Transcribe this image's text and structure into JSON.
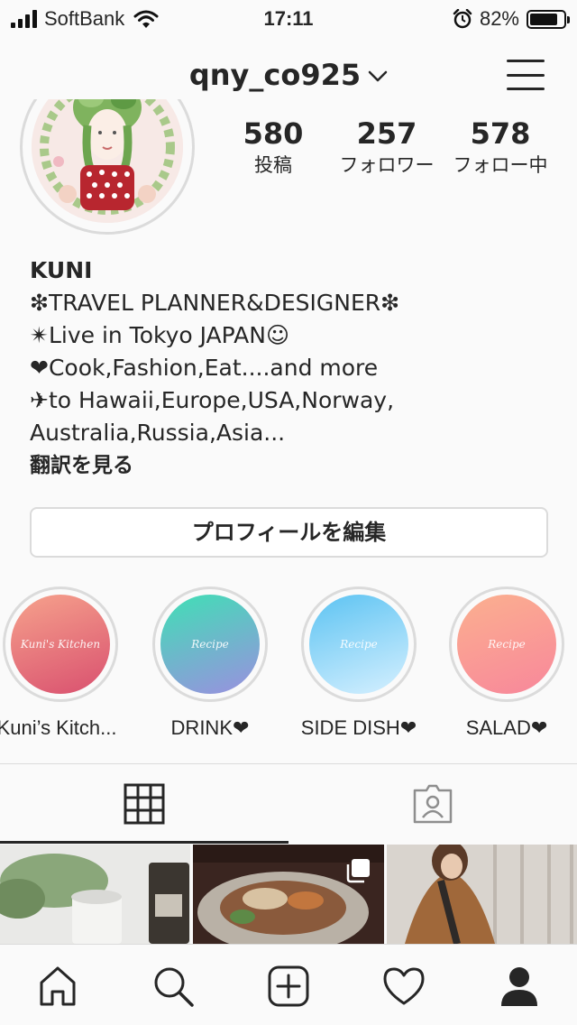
{
  "status_bar": {
    "carrier": "SoftBank",
    "time": "17:11",
    "battery_percent": "82%",
    "battery_level": 0.82,
    "icons": [
      "signal-icon",
      "wifi-icon",
      "alarm-icon",
      "battery-icon"
    ]
  },
  "header": {
    "username": "qny_co925",
    "icons": [
      "chevron-down-icon",
      "menu-icon"
    ]
  },
  "profile": {
    "stats": [
      {
        "value": "580",
        "label": "投稿"
      },
      {
        "value": "257",
        "label": "フォロワー"
      },
      {
        "value": "578",
        "label": "フォロー中"
      }
    ],
    "name": "KUNI",
    "bio_lines": [
      "❇︎TRAVEL PLANNER&DESIGNER❇︎",
      "✴︎Live in Tokyo JAPAN☺︎",
      "❤Cook,Fashion,Eat....and more",
      "✈to Hawaii,Europe,USA,Norway,",
      "Australia,Russia,Asia..."
    ],
    "translate_label": "翻訳を見る",
    "edit_profile_label": "プロフィールを編集"
  },
  "highlights": [
    {
      "label": "Kuni’s Kitch...",
      "cover_text": "Kuni's Kitchen",
      "colors": [
        "#f6a28c",
        "#d9506f"
      ]
    },
    {
      "label": "DRINK❤",
      "cover_text": "Recipe",
      "colors": [
        "#3fe0b5",
        "#9b8fe0"
      ]
    },
    {
      "label": "SIDE DISH❤",
      "cover_text": "Recipe",
      "colors": [
        "#5cc3f2",
        "#d6f0ff"
      ]
    },
    {
      "label": "SALAD❤",
      "cover_text": "Recipe",
      "colors": [
        "#fbb08f",
        "#f8879b"
      ]
    }
  ],
  "tabs": [
    {
      "name": "grid",
      "icon": "grid-icon",
      "active": true
    },
    {
      "name": "tagged",
      "icon": "tagged-person-icon",
      "active": false
    }
  ],
  "bottom_nav": [
    "home-icon",
    "search-icon",
    "new-post-icon",
    "activity-heart-icon",
    "profile-icon"
  ],
  "colors": {
    "background": "#fafafa",
    "text": "#262626",
    "border": "#dbdbdb"
  }
}
